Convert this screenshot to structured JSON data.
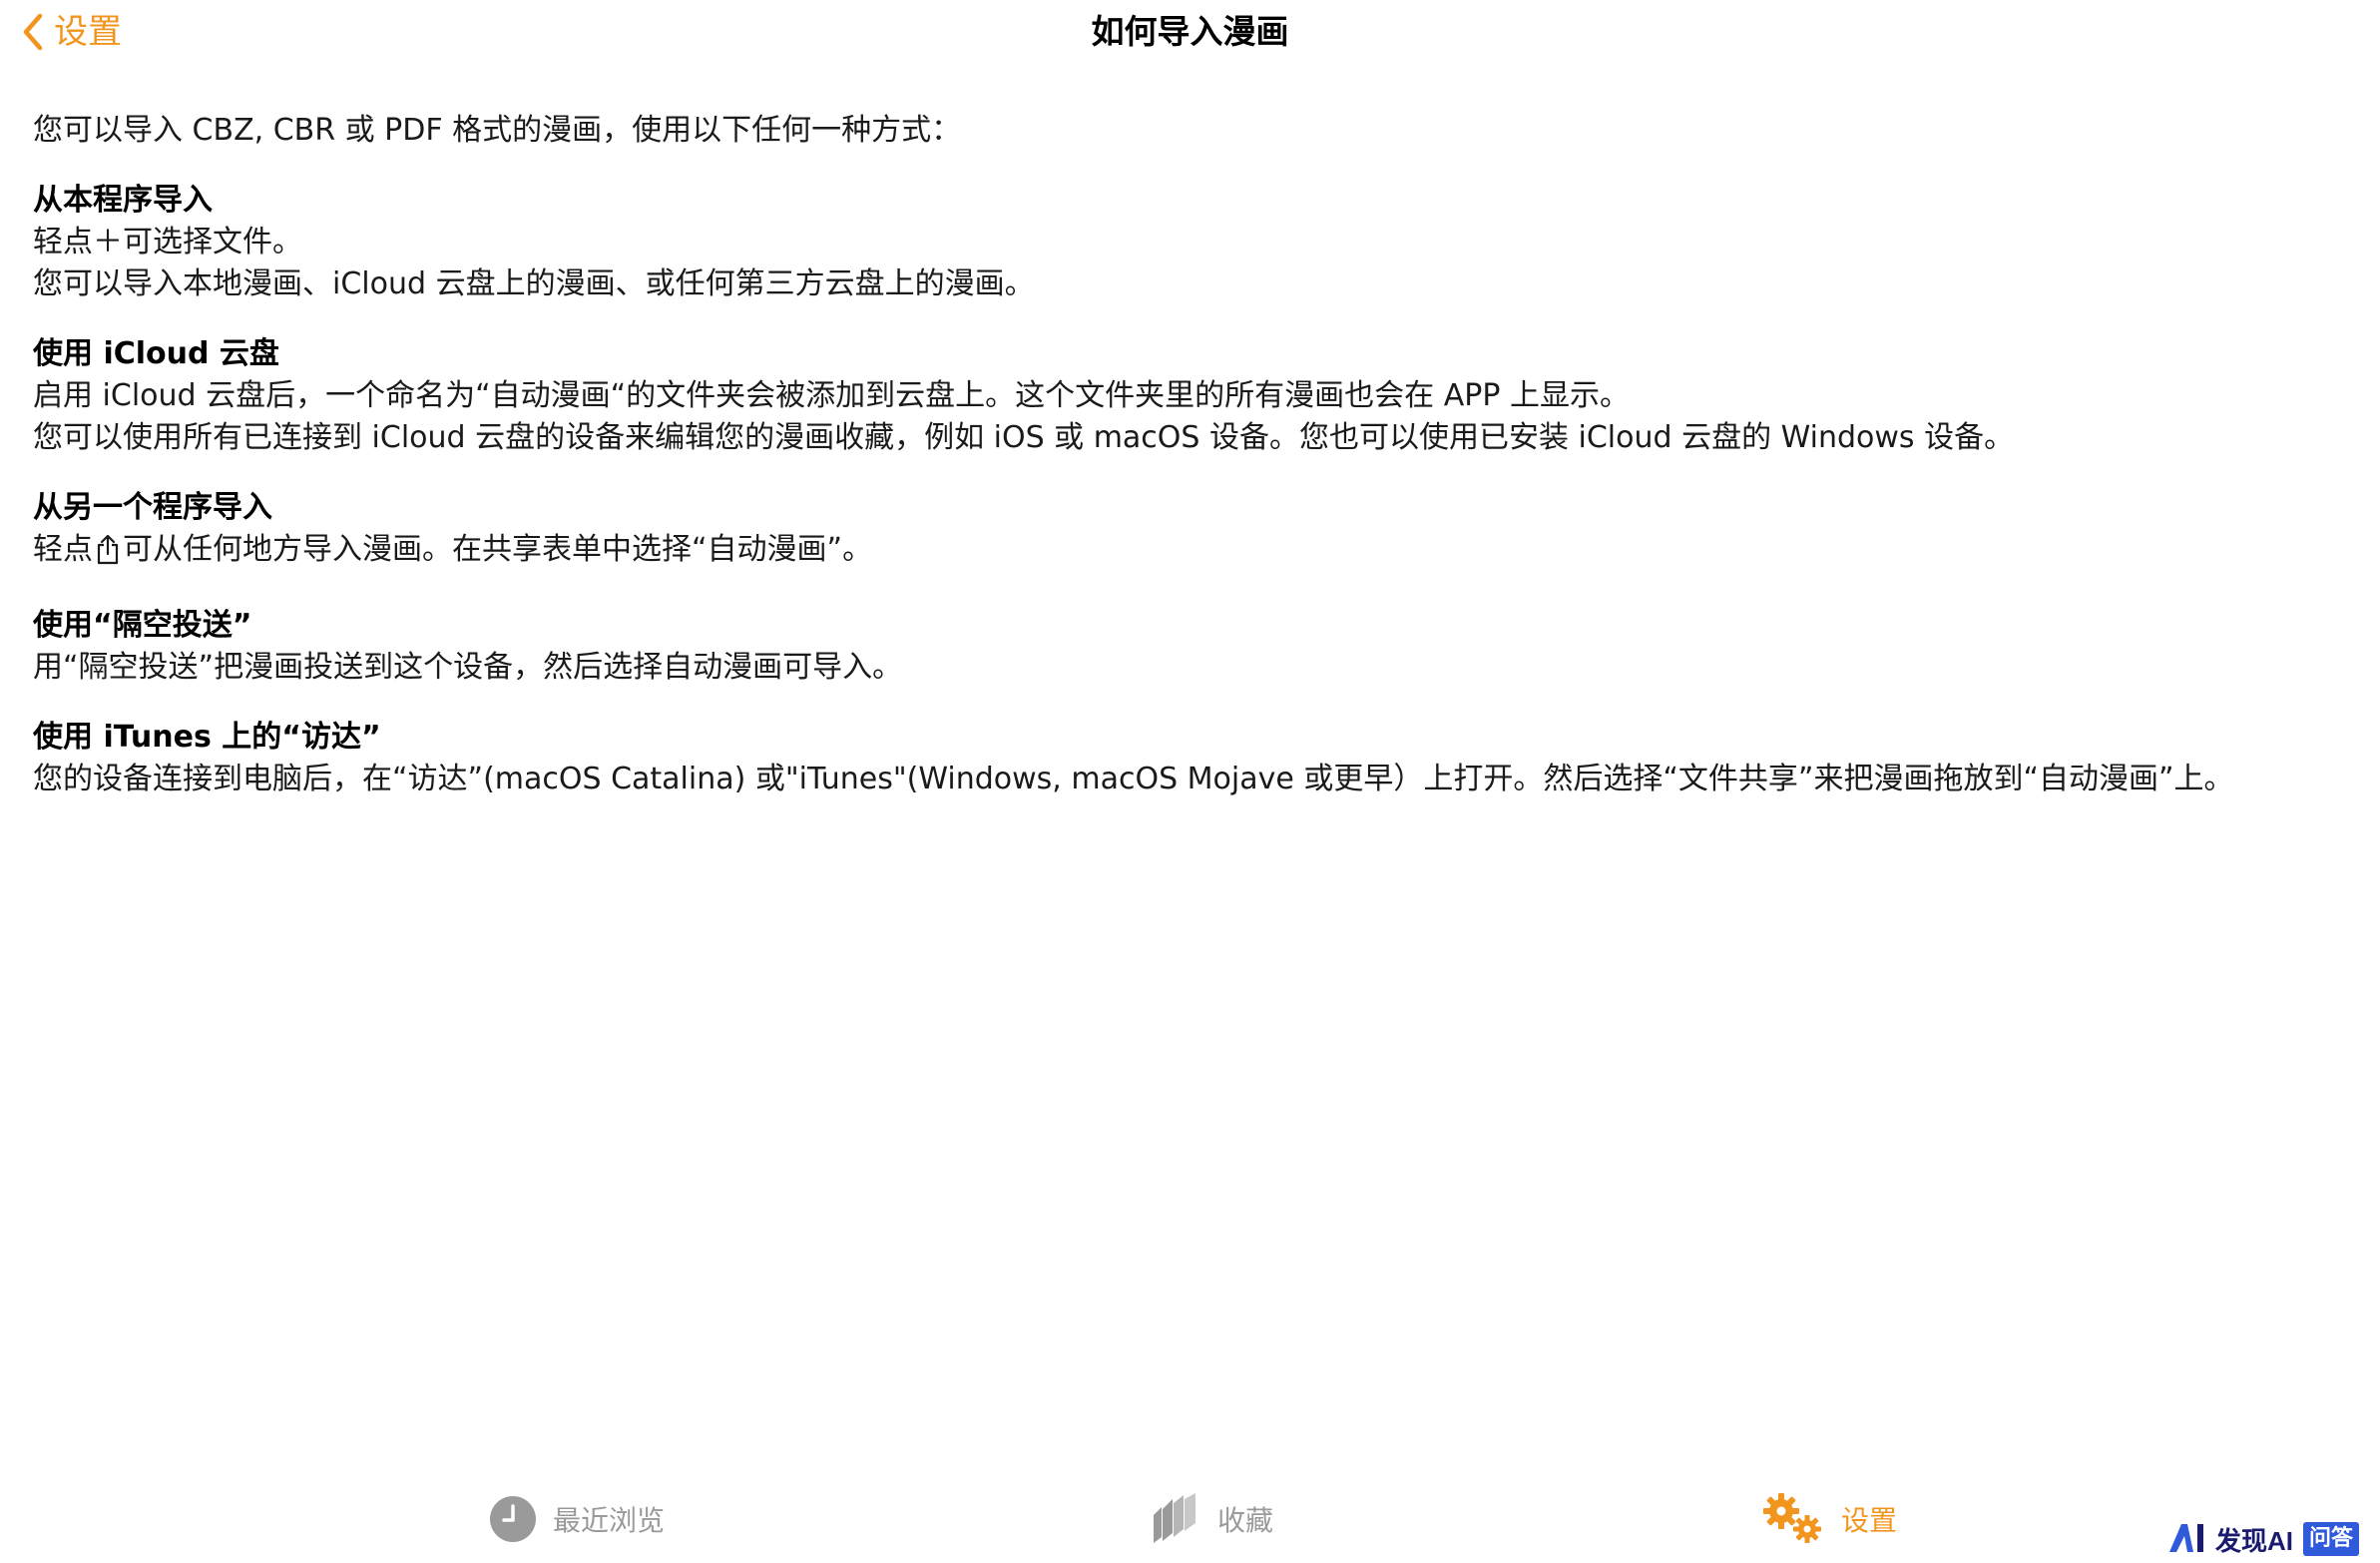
{
  "colors": {
    "accent": "#F2951F",
    "tab_inactive": "#9a9a9a",
    "text": "#1a1a1a"
  },
  "nav": {
    "back_label": "设置",
    "back_icon": "chevron-left-icon",
    "title": "如何导入漫画"
  },
  "content": {
    "intro": "您可以导入 CBZ, CBR 或 PDF 格式的漫画，使用以下任何一种方式：",
    "sections": [
      {
        "heading": "从本程序导入",
        "lines": [
          "轻点＋可选择文件。",
          "您可以导入本地漫画、iCloud 云盘上的漫画、或任何第三方云盘上的漫画。"
        ]
      },
      {
        "heading": "使用 iCloud 云盘",
        "lines": [
          "启用 iCloud 云盘后，一个命名为“自动漫画“的文件夹会被添加到云盘上。这个文件夹里的所有漫画也会在 APP 上显示。",
          "您可以使用所有已连接到 iCloud 云盘的设备来编辑您的漫画收藏，例如 iOS 或 macOS 设备。您也可以使用已安装 iCloud 云盘的 Windows 设备。"
        ]
      },
      {
        "heading": "从另一个程序导入",
        "line_before_icon": "轻点",
        "share_icon": "share-icon",
        "line_after_icon": "可从任何地方导入漫画。在共享表单中选择“自动漫画”。"
      },
      {
        "heading": "使用“隔空投送”",
        "lines": [
          "用“隔空投送”把漫画投送到这个设备，然后选择自动漫画可导入。"
        ]
      },
      {
        "heading": "使用 iTunes 上的“访达”",
        "lines": [
          "您的设备连接到电脑后，在“访达”(macOS Catalina) 或\"iTunes\"(Windows, macOS Mojave 或更早）上打开。然后选择“文件共享”来把漫画拖放到“自动漫画”上。"
        ]
      }
    ]
  },
  "tabs": [
    {
      "label": "最近浏览",
      "icon": "clock-icon",
      "selected": false
    },
    {
      "label": "收藏",
      "icon": "books-icon",
      "selected": false
    },
    {
      "label": "设置",
      "icon": "gears-icon",
      "selected": true
    }
  ],
  "watermark": {
    "text": "发现AI",
    "badge": "问答"
  }
}
